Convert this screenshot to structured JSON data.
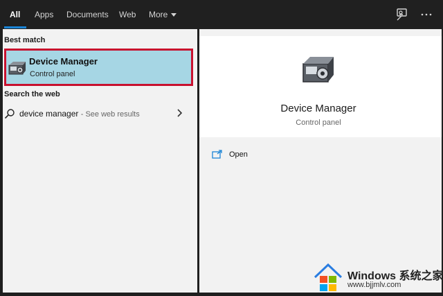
{
  "tabs": [
    {
      "label": "All",
      "active": true
    },
    {
      "label": "Apps"
    },
    {
      "label": "Documents"
    },
    {
      "label": "Web"
    },
    {
      "label": "More"
    }
  ],
  "toolbar": {
    "feedback_icon": "feedback-icon",
    "more_icon": "ellipsis-icon",
    "accent": "#1a84d6"
  },
  "results": {
    "best_match_heading": "Best match",
    "best_match": {
      "title": "Device Manager",
      "subtitle": "Control panel",
      "icon": "device-manager-icon",
      "highlight": "#c8102e"
    },
    "web_heading": "Search the web",
    "web_result": {
      "query": "device manager",
      "hint": "- See web results"
    }
  },
  "detail": {
    "title": "Device Manager",
    "subtitle": "Control panel",
    "actions": [
      {
        "label": "Open",
        "icon": "open-icon"
      }
    ]
  },
  "watermark": {
    "brand": "Windows 系统之家",
    "url": "www.bjjmlv.com"
  }
}
